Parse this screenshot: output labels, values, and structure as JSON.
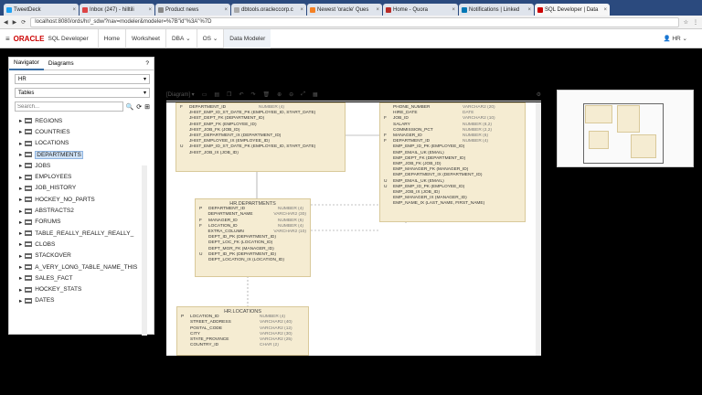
{
  "browser": {
    "tabs": [
      {
        "label": "TweetDeck",
        "color": "#1da1f2"
      },
      {
        "label": "Inbox (247) - hilltili",
        "color": "#d44"
      },
      {
        "label": "Product news",
        "color": "#888"
      },
      {
        "label": "dbtools.oracleccorp.c",
        "color": "#aaa"
      },
      {
        "label": "Newest 'oracle' Ques",
        "color": "#f48024"
      },
      {
        "label": "Home - Quora",
        "color": "#b92b27"
      },
      {
        "label": "Notifications | Linked",
        "color": "#0077b5"
      },
      {
        "label": "SQL Developer | Data",
        "color": "#c00"
      }
    ],
    "url": "localhost:8080/ords/hr/_sdw/?nav=modeler&modeler=%7B\"id\"%3A\"%7D"
  },
  "app": {
    "logo": "ORACLE",
    "product": "SQL Developer",
    "tabs": [
      "Home",
      "Worksheet",
      "DBA",
      "OS",
      "Data Modeler"
    ],
    "user": "HR"
  },
  "navigator": {
    "tabs": [
      "Navigator",
      "Diagrams"
    ],
    "schema": "HR",
    "objtype": "Tables",
    "search_placeholder": "Search...",
    "items": [
      "REGIONS",
      "COUNTRIES",
      "LOCATIONS",
      "DEPARTMENTS",
      "JOBS",
      "EMPLOYEES",
      "JOB_HISTORY",
      "HOCKEY_NO_PARTS",
      "ABSTRACTS2",
      "FORUMS",
      "TABLE_REALLY_REALLY_REALLY_",
      "CLOBS",
      "STACKOVER",
      "A_VERY_LONG_TABLE_NAME_THIS",
      "SALES_FACT",
      "HOCKEY_STATS",
      "DATES"
    ]
  },
  "diagram": {
    "label": "[Diagram]",
    "jh": {
      "rows": [
        [
          "F",
          "DEPARTMENT_ID",
          "NUMBER (4)"
        ],
        [
          "",
          "JHIST_EMP_ID_ST_DATE_PK (EMPLOYEE_ID, START_DATE)",
          ""
        ],
        [
          "",
          "JHIST_DEPT_FK (DEPARTMENT_ID)",
          ""
        ],
        [
          "",
          "JHIST_EMP_FK (EMPLOYEE_ID)",
          ""
        ],
        [
          "",
          "JHIST_JOB_FK (JOB_ID)",
          ""
        ],
        [
          "",
          "JHIST_DEPARTMENT_IX (DEPARTMENT_ID)",
          ""
        ],
        [
          "",
          "JHIST_EMPLOYEE_IX (EMPLOYEE_ID)",
          ""
        ],
        [
          "U",
          "JHIST_EMP_ID_ST_DATE_PK (EMPLOYEE_ID, START_DATE)",
          ""
        ],
        [
          "",
          "JHIST_JOB_IX (JOB_ID)",
          ""
        ]
      ]
    },
    "emp": {
      "rows": [
        [
          "",
          "PHONE_NUMBER",
          "VARCHAR2 (20)"
        ],
        [
          "",
          "HIRE_DATE",
          "DATE"
        ],
        [
          "F",
          "JOB_ID",
          "VARCHAR2 (10)"
        ],
        [
          "",
          "SALARY",
          "NUMBER (8,2)"
        ],
        [
          "",
          "COMMISSION_PCT",
          "NUMBER (2,2)"
        ],
        [
          "F",
          "MANAGER_ID",
          "NUMBER (6)"
        ],
        [
          "F",
          "DEPARTMENT_ID",
          "NUMBER (4)"
        ],
        [
          "",
          "EMP_EMP_ID_PK (EMPLOYEE_ID)",
          ""
        ],
        [
          "",
          "EMP_EMAIL_UK (EMAIL)",
          ""
        ],
        [
          "",
          "EMP_DEPT_FK (DEPARTMENT_ID)",
          ""
        ],
        [
          "",
          "EMP_JOB_FK (JOB_ID)",
          ""
        ],
        [
          "",
          "EMP_MANAGER_FK (MANAGER_ID)",
          ""
        ],
        [
          "",
          "EMP_DEPARTMENT_IX (DEPARTMENT_ID)",
          ""
        ],
        [
          "U",
          "EMP_EMAIL_UK (EMAIL)",
          ""
        ],
        [
          "U",
          "EMP_EMP_ID_PK (EMPLOYEE_ID)",
          ""
        ],
        [
          "",
          "EMP_JOB_IX (JOB_ID)",
          ""
        ],
        [
          "",
          "EMP_MANAGER_IX (MANAGER_ID)",
          ""
        ],
        [
          "",
          "EMP_NAME_IX (LAST_NAME, FIRST_NAME)",
          ""
        ]
      ]
    },
    "dept": {
      "title": "HR.DEPARTMENTS",
      "rows": [
        [
          "P",
          "DEPARTMENT_ID",
          "NUMBER (4)"
        ],
        [
          "",
          "DEPARTMENT_NAME",
          "VARCHAR2 (30)"
        ],
        [
          "F",
          "MANAGER_ID",
          "NUMBER (6)"
        ],
        [
          "F",
          "LOCATION_ID",
          "NUMBER (4)"
        ],
        [
          "",
          "EXTRA_COLUMN",
          "VARCHAR2 (10)"
        ],
        [
          "",
          "DEPT_ID_PK (DEPARTMENT_ID)",
          ""
        ],
        [
          "",
          "DEPT_LOC_FK (LOCATION_ID)",
          ""
        ],
        [
          "",
          "DEPT_MGR_FK (MANAGER_ID)",
          ""
        ],
        [
          "U",
          "DEPT_ID_PK (DEPARTMENT_ID)",
          ""
        ],
        [
          "",
          "DEPT_LOCATION_IX (LOCATION_ID)",
          ""
        ]
      ]
    },
    "loc": {
      "title": "HR.LOCATIONS",
      "rows": [
        [
          "P",
          "LOCATION_ID",
          "NUMBER (4)"
        ],
        [
          "",
          "STREET_ADDRESS",
          "VARCHAR2 (40)"
        ],
        [
          "",
          "POSTAL_CODE",
          "VARCHAR2 (12)"
        ],
        [
          "",
          "CITY",
          "VARCHAR2 (30)"
        ],
        [
          "",
          "STATE_PROVINCE",
          "VARCHAR2 (25)"
        ],
        [
          "",
          "COUNTRY_ID",
          "CHAR (2)"
        ]
      ]
    }
  }
}
